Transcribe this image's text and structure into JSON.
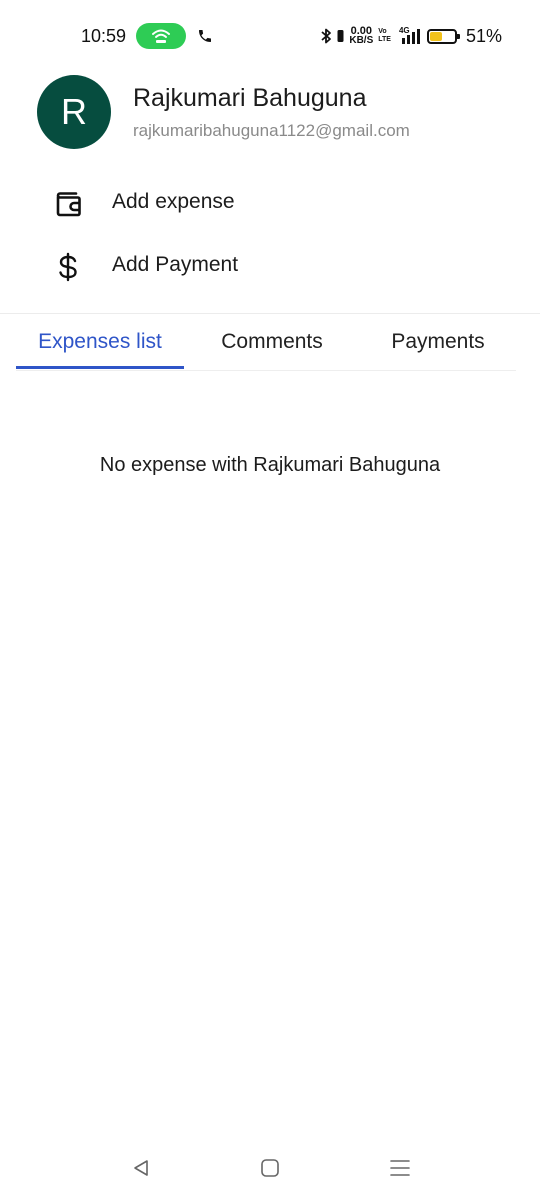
{
  "status_bar": {
    "time": "10:59",
    "net_speed_value": "0.00",
    "net_speed_unit": "KB/S",
    "volte_top": "Vo",
    "volte_bottom": "LTE",
    "network_type": "4G",
    "battery_percent": "51%",
    "battery_level": 0.51,
    "hotspot_color": "#2ecc55",
    "battery_color": "#f2c21b"
  },
  "profile": {
    "initial": "R",
    "name": "Rajkumari Bahuguna",
    "email": "rajkumaribahuguna1122@gmail.com",
    "avatar_color": "#064d3f"
  },
  "actions": {
    "add_expense": {
      "label": "Add expense",
      "icon": "wallet-icon"
    },
    "add_payment": {
      "label": "Add Payment",
      "icon": "dollar-icon"
    }
  },
  "tabs": [
    {
      "label": "Expenses list",
      "active": true
    },
    {
      "label": "Comments",
      "active": false
    },
    {
      "label": "Payments",
      "active": false
    }
  ],
  "accent_color": "#2f55c8",
  "empty_state": {
    "message": "No expense with Rajkumari Bahuguna"
  },
  "nav_bar": {
    "back_icon": "back-triangle-icon",
    "home_icon": "home-square-icon",
    "recents_icon": "menu-lines-icon"
  }
}
